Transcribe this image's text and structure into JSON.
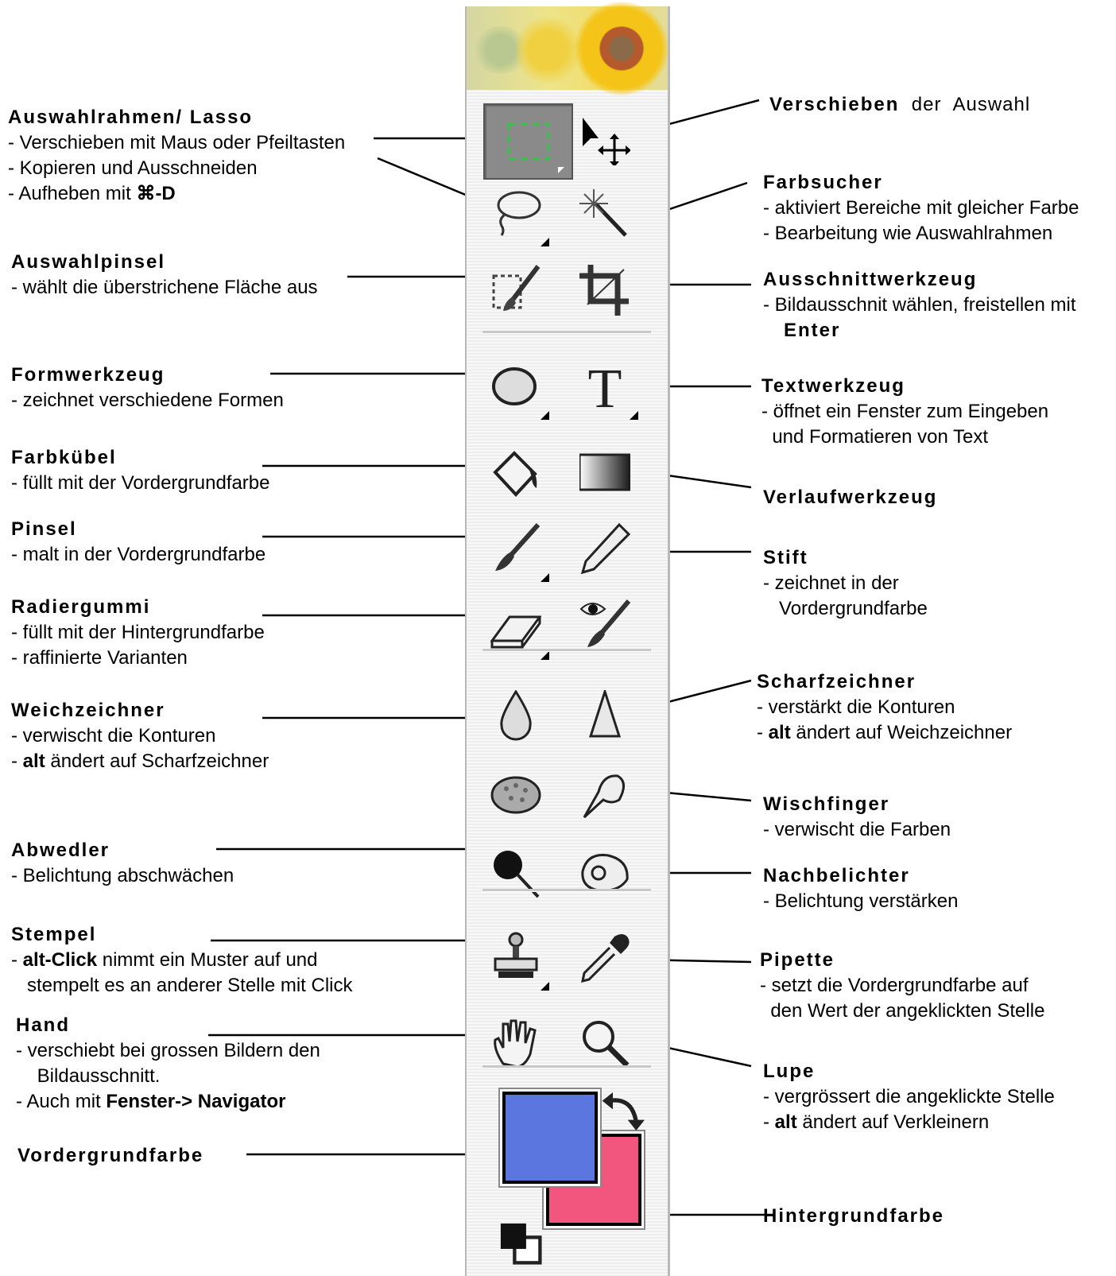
{
  "labels": {
    "auswahlrahmen": {
      "title": "Auswahlrahmen/  Lasso",
      "lines": [
        "- Verschieben mit Maus oder Pfeiltasten",
        "- Kopieren und Ausschneiden"
      ],
      "line3_prefix": "- Aufheben mit ",
      "line3_key": "⌘-D"
    },
    "auswahlpinsel": {
      "title": "Auswahlpinsel",
      "lines": [
        "- wählt die überstrichene Fläche aus"
      ]
    },
    "formwerkzeug": {
      "title": "Formwerkzeug",
      "lines": [
        "- zeichnet verschiedene Formen"
      ]
    },
    "farbkuebel": {
      "title": "Farbkübel",
      "lines": [
        "- füllt mit der Vordergrundfarbe"
      ]
    },
    "pinsel": {
      "title": "Pinsel",
      "lines": [
        "- malt in der Vordergrundfarbe"
      ]
    },
    "radiergummi": {
      "title": "Radiergummi",
      "lines": [
        "- füllt mit der Hintergrundfarbe",
        "- raffinierte Varianten"
      ]
    },
    "weichzeichner": {
      "title": "Weichzeichner",
      "line1": "- verwischt die Konturen",
      "line2_prefix": "- ",
      "line2_bold": "alt",
      "line2_rest": " ändert auf Scharfzeichner"
    },
    "abwedler": {
      "title": "Abwedler",
      "lines": [
        "- Belichtung abschwächen"
      ]
    },
    "stempel": {
      "title": "Stempel",
      "line1_prefix": "- ",
      "line1_bold": "alt-Click",
      "line1_rest": " nimmt ein Muster auf und",
      "line2": "   stempelt es an anderer Stelle mit Click"
    },
    "hand": {
      "title": "Hand",
      "line1": "- verschiebt bei grossen Bildern den",
      "line2": "    Bildausschnitt.",
      "line3_prefix": "- Auch mit ",
      "line3_bold": "Fenster->  Navigator"
    },
    "vordergrundfarbe": {
      "title": "Vordergrundfarbe"
    },
    "verschieben": {
      "title": "Verschieben",
      "rest": "  der  Auswahl"
    },
    "farbsucher": {
      "title": "Farbsucher",
      "lines": [
        "- aktiviert Bereiche mit gleicher Farbe",
        "- Bearbeitung wie Auswahlrahmen"
      ]
    },
    "ausschnitt": {
      "title": "Ausschnittwerkzeug",
      "line1": "- Bildausschnit wählen, freistellen mit",
      "line2_bold": "Enter"
    },
    "text": {
      "title": "Textwerkzeug",
      "lines": [
        "- öffnet ein Fenster zum Eingeben",
        "  und Formatieren von Text"
      ]
    },
    "verlauf": {
      "title": "Verlaufwerkzeug"
    },
    "stift": {
      "title": "Stift",
      "lines": [
        "- zeichnet in der",
        "   Vordergrundfarbe"
      ]
    },
    "scharf": {
      "title": "Scharfzeichner",
      "line1": "- verstärkt die Konturen",
      "line2_prefix": "- ",
      "line2_bold": "alt",
      "line2_rest": " ändert auf Weichzeichner"
    },
    "wischfinger": {
      "title": "Wischfinger",
      "lines": [
        "- verwischt die Farben"
      ]
    },
    "nachbelichter": {
      "title": "Nachbelichter",
      "lines": [
        "- Belichtung verstärken"
      ]
    },
    "pipette": {
      "title": "Pipette",
      "lines": [
        "- setzt die Vordergrundfarbe auf",
        "  den Wert der angeklickten Stelle"
      ]
    },
    "lupe": {
      "title": "Lupe",
      "line1": "- vergrössert die angeklickte Stelle",
      "line2_prefix": "- ",
      "line2_bold": "alt",
      "line2_rest": " ändert auf Verkleinern"
    },
    "hintergrundfarbe": {
      "title": "Hintergrundfarbe"
    }
  },
  "colors": {
    "foreground": "#5b76df",
    "background": "#f2557e"
  },
  "icons": [
    "marquee-icon",
    "move-icon",
    "lasso-icon",
    "magic-wand-icon",
    "selection-brush-icon",
    "crop-icon",
    "ellipse-icon",
    "text-icon",
    "paint-bucket-icon",
    "gradient-icon",
    "brush-icon",
    "pencil-icon",
    "eraser-icon",
    "red-eye-icon",
    "blur-icon",
    "sharpen-icon",
    "sponge-icon",
    "smudge-icon",
    "dodge-icon",
    "burn-icon",
    "clone-stamp-icon",
    "eyedropper-icon",
    "hand-icon",
    "zoom-icon",
    "swap-colors-icon",
    "default-colors-icon"
  ]
}
